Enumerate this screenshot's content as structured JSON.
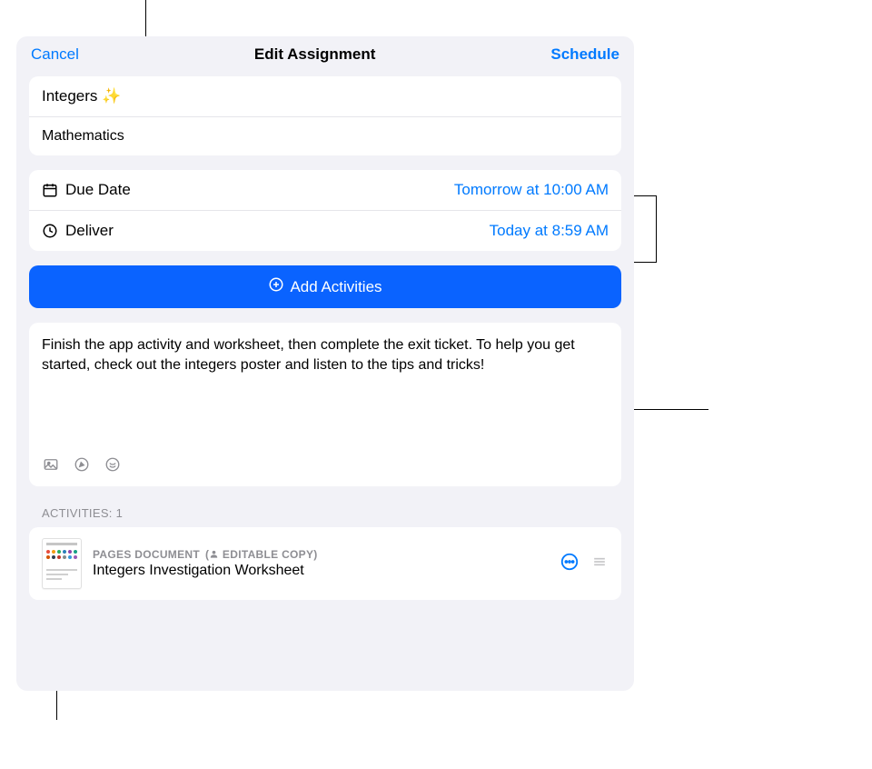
{
  "header": {
    "cancel": "Cancel",
    "title": "Edit Assignment",
    "action": "Schedule"
  },
  "assignment": {
    "title": "Integers ✨",
    "subject": "Mathematics"
  },
  "schedule": {
    "due_label": "Due Date",
    "due_value": "Tomorrow at 10:00 AM",
    "deliver_label": "Deliver",
    "deliver_value": "Today at 8:59 AM"
  },
  "add_activities_label": "Add Activities",
  "description": "Finish the app activity and worksheet, then complete the exit ticket. To help you get started, check out the integers poster and listen to the tips and tricks!",
  "activities_header": "ACTIVITIES: 1",
  "activity": {
    "type": "PAGES DOCUMENT",
    "badge": "EDITABLE COPY",
    "title": "Integers Investigation Worksheet"
  },
  "icons": {
    "calendar": "calendar-icon",
    "clock": "clock-icon",
    "plus": "plus-circle-icon",
    "photo": "photo-icon",
    "draw": "draw-icon",
    "audio": "audio-icon",
    "person": "person-icon",
    "more": "ellipsis-circle-icon",
    "reorder": "reorder-icon"
  }
}
